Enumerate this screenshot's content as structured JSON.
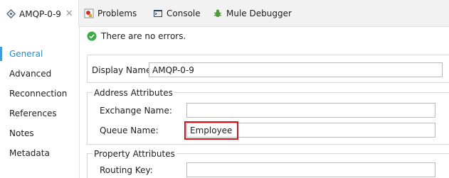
{
  "tabs": [
    {
      "label": "AMQP-0-9",
      "icon": "connector-icon",
      "active": true
    },
    {
      "label": "Problems",
      "icon": "problems-icon"
    },
    {
      "label": "Console",
      "icon": "console-icon"
    },
    {
      "label": "Mule Debugger",
      "icon": "mule-debugger-icon"
    }
  ],
  "nav": [
    "General",
    "Advanced",
    "Reconnection",
    "References",
    "Notes",
    "Metadata"
  ],
  "status": {
    "text": "There are no errors.",
    "icon": "check-icon"
  },
  "display": {
    "label": "Display Name:",
    "value": "AMQP-0-9"
  },
  "address": {
    "title": "Address Attributes",
    "exchange_label": "Exchange Name:",
    "exchange_value": "",
    "queue_label": "Queue Name:",
    "queue_value": "Employee"
  },
  "property": {
    "title": "Property Attributes",
    "routing_label": "Routing Key:",
    "routing_value": ""
  },
  "colors": {
    "accent": "#1a8fd8",
    "highlight": "#d7141e",
    "success": "#3cab4a"
  }
}
